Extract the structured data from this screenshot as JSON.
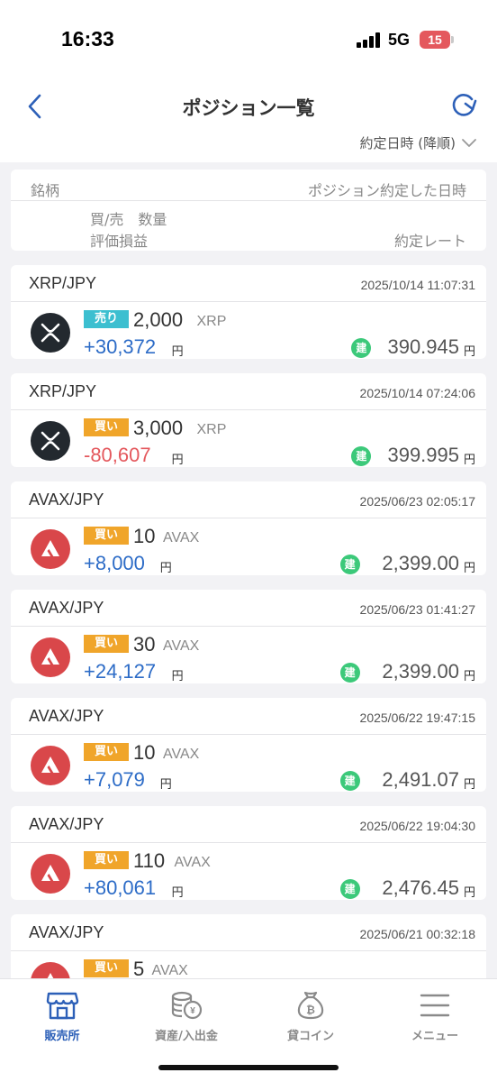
{
  "status_bar": {
    "time": "16:33",
    "network": "5G",
    "battery": "15"
  },
  "nav": {
    "title": "ポジション一覧",
    "sort_label": "約定日時 (降順)"
  },
  "list_header": {
    "symbol": "銘柄",
    "position_datetime": "ポジション約定した日時",
    "side_qty": "買/売　数量",
    "pnl": "評価損益",
    "rate": "約定レート"
  },
  "positions": [
    {
      "pair": "XRP/JPY",
      "datetime": "2025/10/14 11:07:31",
      "coin_icon": "xrp-icon",
      "side": "売り",
      "quantity": "2,000",
      "unit": "XRP",
      "pnl": "+30,372",
      "yen": "円",
      "open_badge": "建",
      "rate": "390.945"
    },
    {
      "pair": "XRP/JPY",
      "datetime": "2025/10/14 07:24:06",
      "coin_icon": "xrp-icon",
      "side": "買い",
      "quantity": "3,000",
      "unit": "XRP",
      "pnl": "-80,607",
      "yen": "円",
      "open_badge": "建",
      "rate": "399.995"
    },
    {
      "pair": "AVAX/JPY",
      "datetime": "2025/06/23 02:05:17",
      "coin_icon": "avax-icon",
      "side": "買い",
      "quantity": "10",
      "unit": "AVAX",
      "pnl": "+8,000",
      "yen": "円",
      "open_badge": "建",
      "rate": "2,399.00"
    },
    {
      "pair": "AVAX/JPY",
      "datetime": "2025/06/23 01:41:27",
      "coin_icon": "avax-icon",
      "side": "買い",
      "quantity": "30",
      "unit": "AVAX",
      "pnl": "+24,127",
      "yen": "円",
      "open_badge": "建",
      "rate": "2,399.00"
    },
    {
      "pair": "AVAX/JPY",
      "datetime": "2025/06/22 19:47:15",
      "coin_icon": "avax-icon",
      "side": "買い",
      "quantity": "10",
      "unit": "AVAX",
      "pnl": "+7,079",
      "yen": "円",
      "open_badge": "建",
      "rate": "2,491.07"
    },
    {
      "pair": "AVAX/JPY",
      "datetime": "2025/06/22 19:04:30",
      "coin_icon": "avax-icon",
      "side": "買い",
      "quantity": "110",
      "unit": "AVAX",
      "pnl": "+80,061",
      "yen": "円",
      "open_badge": "建",
      "rate": "2,476.45"
    },
    {
      "pair": "AVAX/JPY",
      "datetime": "2025/06/21 00:32:18",
      "coin_icon": "avax-icon",
      "side": "買い",
      "quantity": "5",
      "unit": "AVAX",
      "pnl": "",
      "yen": "",
      "open_badge": "",
      "rate": ""
    }
  ],
  "tabbar": [
    {
      "label": "販売所",
      "icon": "store-icon",
      "active": true
    },
    {
      "label": "資産/入出金",
      "icon": "coins-yen-icon",
      "active": false
    },
    {
      "label": "貸コイン",
      "icon": "money-bag-icon",
      "active": false
    },
    {
      "label": "メニュー",
      "icon": "menu-icon",
      "active": false
    }
  ],
  "colors": {
    "accent": "#2d60b8",
    "positive": "#2d6cc7",
    "negative": "#e4585d",
    "sell_badge": "#3cbfd0",
    "buy_badge": "#f0a52a",
    "open_badge": "#3cc97a",
    "xrp_bg": "#23292f",
    "avax_bg": "#d9474a"
  }
}
